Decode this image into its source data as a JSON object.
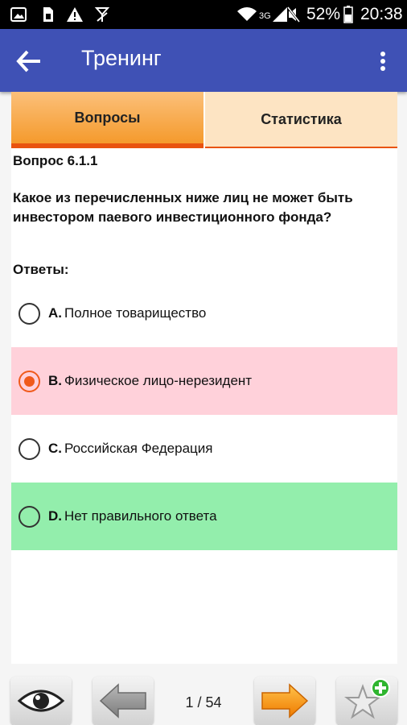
{
  "status_bar": {
    "network": "3G",
    "battery_percent": "52%",
    "time": "20:38",
    "icons": [
      "image-icon",
      "sim-icon",
      "warning-icon",
      "antenna-icon",
      "wifi-icon",
      "signal-icon",
      "mute-icon",
      "battery-icon"
    ]
  },
  "app_bar": {
    "title": "Тренинг",
    "back_icon": "arrow-back-icon",
    "menu_icon": "more-vert-icon"
  },
  "tabs": [
    {
      "label": "Вопросы",
      "active": true
    },
    {
      "label": "Статистика",
      "active": false
    }
  ],
  "question": {
    "number_label": "Вопрос 6.1.1",
    "text": "Какое из перечисленных ниже лиц не может быть инвестором паевого инвестиционного фонда?",
    "answers_label": "Ответы:"
  },
  "answers": [
    {
      "letter": "A.",
      "text": "Полное товарищество",
      "selected": false,
      "state": "none",
      "bg": "#ffffff"
    },
    {
      "letter": "B.",
      "text": "Физическое лицо-нерезидент",
      "selected": true,
      "state": "wrong",
      "bg": "#ffd1da"
    },
    {
      "letter": "C.",
      "text": "Российская Федерация",
      "selected": false,
      "state": "none",
      "bg": "#ffffff"
    },
    {
      "letter": "D.",
      "text": "Нет правильного ответа",
      "selected": false,
      "state": "correct",
      "bg": "#93eeac"
    }
  ],
  "bottom_bar": {
    "page_counter": "1 / 54",
    "current_page": 1,
    "total_pages": 54,
    "buttons": [
      "eye-icon",
      "arrow-left-icon",
      "arrow-right-icon",
      "star-add-icon"
    ]
  },
  "colors": {
    "app_bar": "#3f51b5",
    "tab_accent": "#e9530f",
    "selected_radio": "#f05a1b",
    "wrong_answer_bg": "#ffd1da",
    "correct_answer_bg": "#93eeac"
  }
}
